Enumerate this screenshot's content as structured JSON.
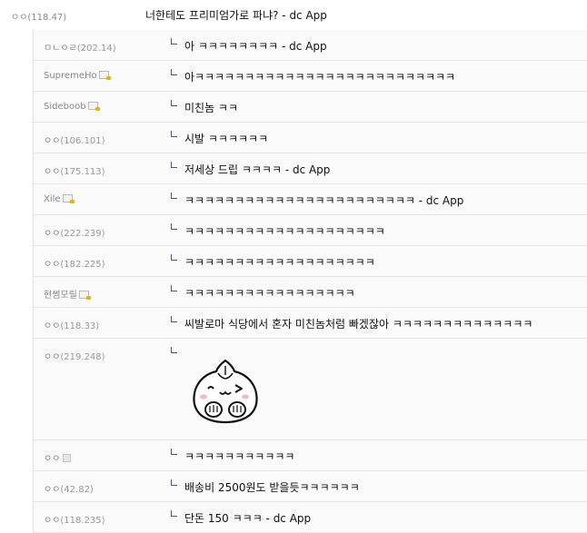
{
  "post": {
    "nick": "ㅇㅇ",
    "ip": "(118.47)",
    "title": "너한테도 프리미엄가로 파냐? - dc App"
  },
  "replies": [
    {
      "nick": "ㅁㄴㅇㄹ",
      "ip": "(202.14)",
      "text": "아 ㅋㅋㅋㅋㅋㅋㅋㅋ - dc App"
    },
    {
      "nick": "SupremeHo",
      "ip": "",
      "text": "아ㅋㅋㅋㅋㅋㅋㅋㅋㅋㅋㅋㅋㅋㅋㅋㅋㅋㅋㅋㅋㅋㅋㅋㅋㅋㅋ"
    },
    {
      "nick": "Sideboob",
      "ip": "",
      "text": "미친놈 ㅋㅋ"
    },
    {
      "nick": "ㅇㅇ",
      "ip": "(106.101)",
      "text": "시발 ㅋㅋㅋㅋㅋㅋ"
    },
    {
      "nick": "ㅇㅇ",
      "ip": "(175.113)",
      "text": "저세상 드립 ㅋㅋㅋㅋ - dc App"
    },
    {
      "nick": "Xile",
      "ip": "",
      "text": "ㅋㅋㅋㅋㅋㅋㅋㅋㅋㅋㅋㅋㅋㅋㅋㅋㅋㅋㅋㅋㅋㅋㅋ - dc App"
    },
    {
      "nick": "ㅇㅇ",
      "ip": "(222.239)",
      "text": "ㅋㅋㅋㅋㅋㅋㅋㅋㅋㅋㅋㅋㅋㅋㅋㅋㅋㅋㅋㅋ"
    },
    {
      "nick": "ㅇㅇ",
      "ip": "(182.225)",
      "text": "ㅋㅋㅋㅋㅋㅋㅋㅋㅋㅋㅋㅋㅋㅋㅋㅋㅋㅋㅋ"
    },
    {
      "nick": "현썸모릴",
      "ip": "",
      "text": "ㅋㅋㅋㅋㅋㅋㅋㅋㅋㅋㅋㅋㅋㅋㅋㅋㅋ"
    },
    {
      "nick": "ㅇㅇ",
      "ip": "(118.33)",
      "text": "씨발로마 식당에서 혼자 미친놈처럼 빠겠잖아 ㅋㅋㅋㅋㅋㅋㅋㅋㅋㅋㅋㅋㅋㅋ"
    },
    {
      "nick": "ㅇㅇ",
      "ip": "(219.248)",
      "text": "",
      "emoticon": "dumpling-emoticon"
    },
    {
      "nick": "ㅇㅇ",
      "ip": "",
      "text": "ㅋㅋㅋㅋㅋㅋㅋㅋㅋㅋㅋ"
    },
    {
      "nick": "ㅇㅇ",
      "ip": "(42.82)",
      "text": "배송비 2500원도 받을듯ㅋㅋㅋㅋㅋㅋ"
    },
    {
      "nick": "ㅇㅇ",
      "ip": "(118.235)",
      "text": "단돈 150 ㅋㅋㅋ - dc App"
    }
  ]
}
